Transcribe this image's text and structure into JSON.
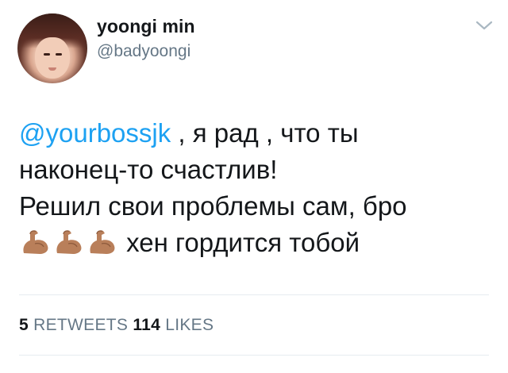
{
  "author": {
    "display_name": "yoongi min",
    "handle": "@badyoongi"
  },
  "menu_icon": "chevron-down-icon",
  "tweet": {
    "mention": "@yourbossjk",
    "line1_rest": " , я рад , что ты",
    "line2": "наконец-то счастлив!",
    "line3": "Решил свои проблемы сам, бро",
    "emojis": [
      "flexed-biceps-medium-skin-tone",
      "flexed-biceps-medium-skin-tone",
      "flexed-biceps-medium-skin-tone"
    ],
    "line4_text": " хен гордится тобой"
  },
  "stats": {
    "retweets_count": "5",
    "retweets_label": "RETWEETS",
    "likes_count": "114",
    "likes_label": "LIKES"
  },
  "colors": {
    "link": "#1da1f2",
    "secondary_text": "#657786",
    "primary_text": "#14171a",
    "divider": "#e6ecf0",
    "emoji_skin": "#b97f5a"
  }
}
